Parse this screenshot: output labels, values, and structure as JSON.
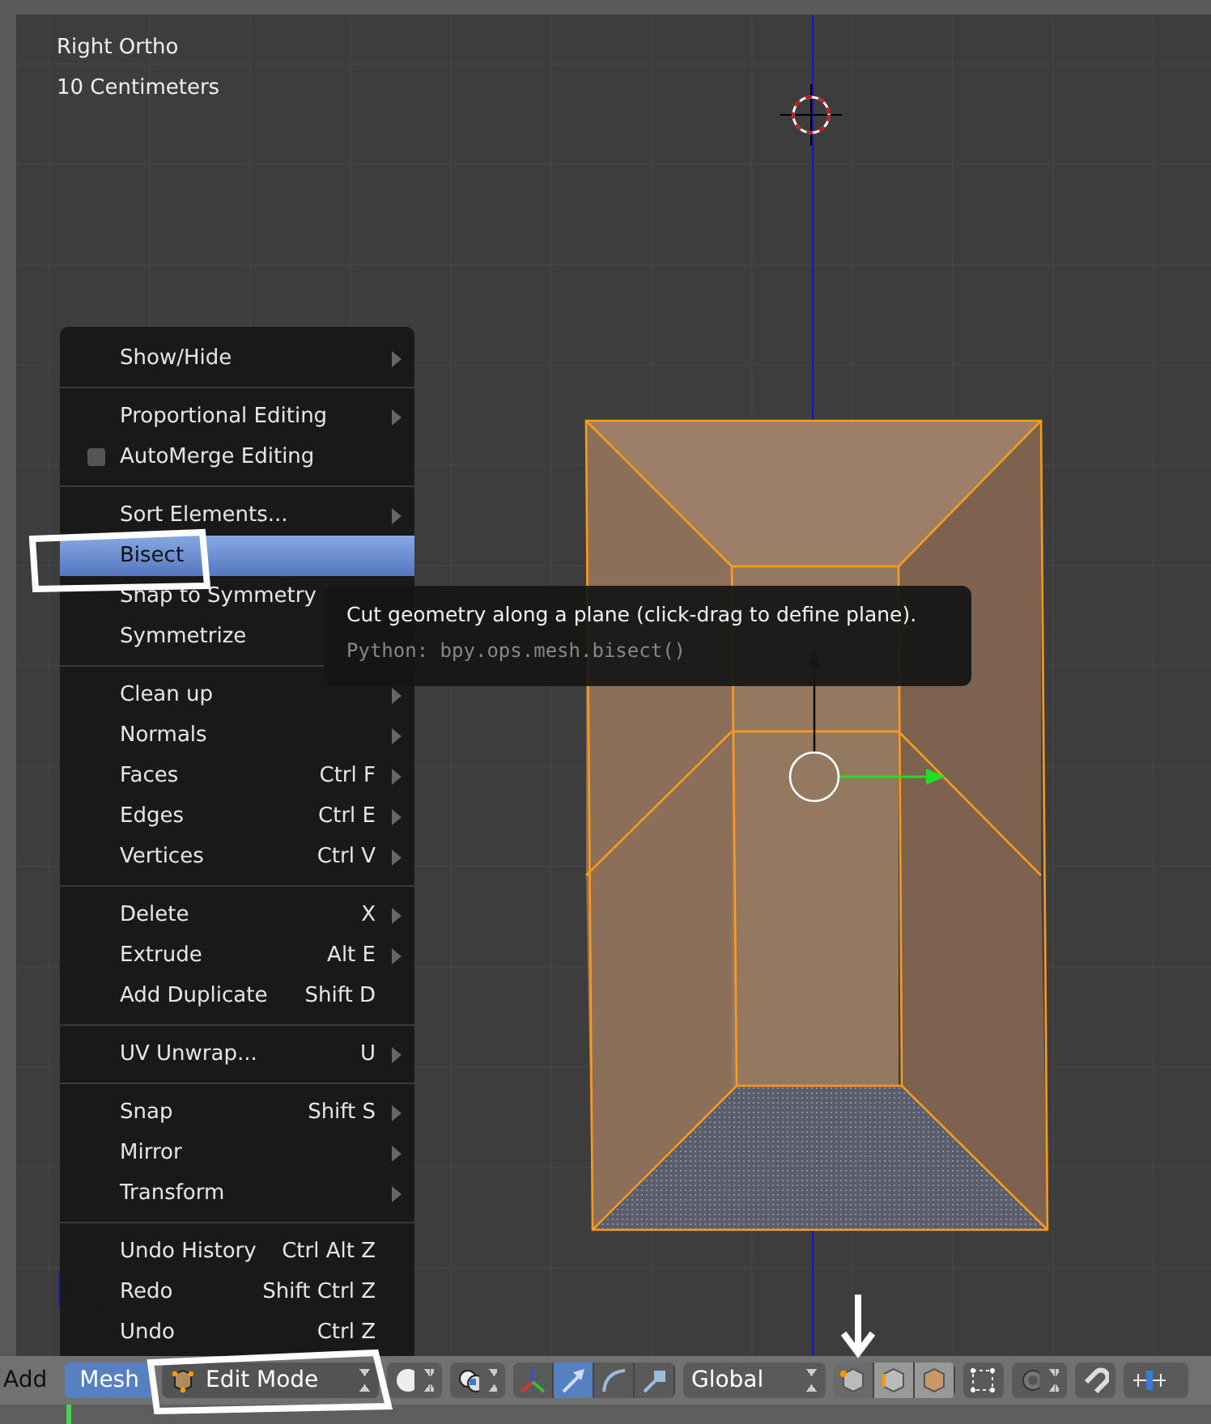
{
  "viewport": {
    "view_name": "Right Ortho",
    "scale_label": "10 Centimeters"
  },
  "menu": {
    "groups": [
      [
        {
          "kind": "item",
          "label": "Show/Hide",
          "submenu": true,
          "selected": false
        }
      ],
      [
        {
          "kind": "item",
          "label": "Proportional Editing",
          "submenu": true,
          "selected": false
        },
        {
          "kind": "checkbox",
          "label": "AutoMerge Editing",
          "checked": false,
          "selected": false
        }
      ],
      [
        {
          "kind": "item",
          "label": "Sort Elements...",
          "submenu": true,
          "selected": false
        },
        {
          "kind": "item",
          "label": "Bisect",
          "submenu": false,
          "selected": true
        },
        {
          "kind": "item",
          "label": "Snap to Symmetry",
          "selected": false
        },
        {
          "kind": "item",
          "label": "Symmetrize",
          "selected": false
        }
      ],
      [
        {
          "kind": "item",
          "label": "Clean up",
          "submenu": true,
          "selected": false
        },
        {
          "kind": "item",
          "label": "Normals",
          "submenu": true,
          "selected": false
        },
        {
          "kind": "item",
          "label": "Faces",
          "shortcut": "Ctrl F",
          "submenu": true,
          "selected": false
        },
        {
          "kind": "item",
          "label": "Edges",
          "shortcut": "Ctrl E",
          "submenu": true,
          "selected": false
        },
        {
          "kind": "item",
          "label": "Vertices",
          "shortcut": "Ctrl V",
          "submenu": true,
          "selected": false
        }
      ],
      [
        {
          "kind": "item",
          "label": "Delete",
          "shortcut": "X",
          "submenu": true,
          "selected": false
        },
        {
          "kind": "item",
          "label": "Extrude",
          "shortcut": "Alt E",
          "submenu": true,
          "selected": false
        },
        {
          "kind": "item",
          "label": "Add Duplicate",
          "shortcut": "Shift D",
          "submenu": false,
          "selected": false
        }
      ],
      [
        {
          "kind": "item",
          "label": "UV Unwrap...",
          "shortcut": "U",
          "submenu": true,
          "selected": false
        }
      ],
      [
        {
          "kind": "item",
          "label": "Snap",
          "shortcut": "Shift S",
          "submenu": true,
          "selected": false
        },
        {
          "kind": "item",
          "label": "Mirror",
          "submenu": true,
          "selected": false
        },
        {
          "kind": "item",
          "label": "Transform",
          "submenu": true,
          "selected": false
        }
      ],
      [
        {
          "kind": "item",
          "label": "Undo History",
          "shortcut": "Ctrl Alt Z",
          "submenu": false,
          "selected": false
        },
        {
          "kind": "item",
          "label": "Redo",
          "shortcut": "Shift Ctrl Z",
          "submenu": false,
          "selected": false
        },
        {
          "kind": "item",
          "label": "Undo",
          "shortcut": "Ctrl Z",
          "submenu": false,
          "selected": false
        }
      ]
    ]
  },
  "tooltip": {
    "description": "Cut geometry along a plane (click-drag to define plane).",
    "python": "Python: bpy.ops.mesh.bisect()"
  },
  "header": {
    "menus": [
      {
        "label": "Add",
        "selected": false
      },
      {
        "label": "Mesh",
        "selected": true
      }
    ],
    "mode_dropdown": {
      "label": "Edit Mode"
    },
    "manipulators": [
      {
        "selected": true
      },
      {
        "selected": false
      },
      {
        "selected": false
      }
    ],
    "orientation_dropdown": {
      "label": "Global"
    },
    "select_modes": [
      {
        "selected": true
      },
      {
        "selected": false
      },
      {
        "selected": false
      }
    ]
  }
}
